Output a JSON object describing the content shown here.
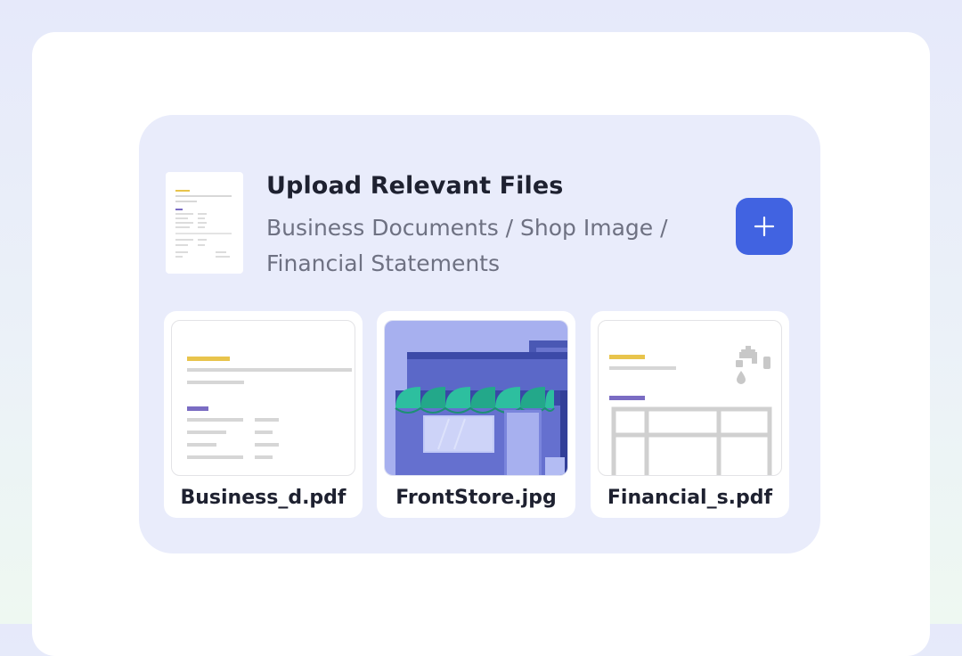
{
  "upload": {
    "title": "Upload Relevant Files",
    "subtitle": "Business Documents / Shop Image / Financial Statements",
    "add_icon": "plus-icon",
    "accent_color": "#4163e1"
  },
  "files": [
    {
      "name": "Business_d.pdf",
      "type": "pdf"
    },
    {
      "name": "FrontStore.jpg",
      "type": "image"
    },
    {
      "name": "Financial_s.pdf",
      "type": "pdf"
    }
  ]
}
